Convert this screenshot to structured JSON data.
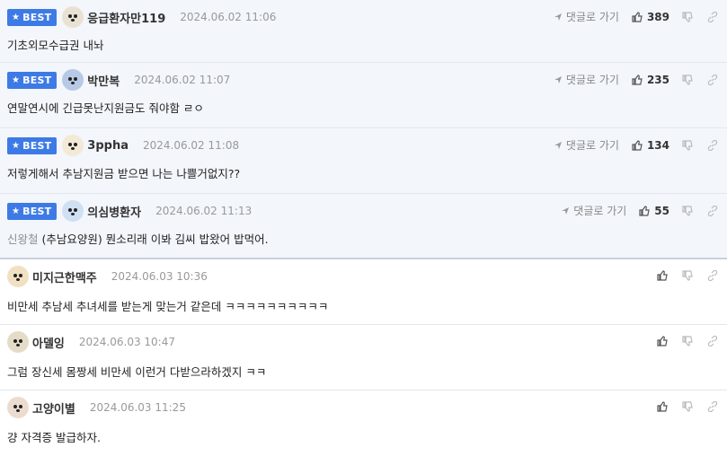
{
  "best_badge": "BEST",
  "reply_label": "댓글로 가기",
  "comments": [
    {
      "nick": "응급환자만119",
      "date": "2024.06.02 11:06",
      "text": "기초외모수급권 내놔",
      "likes": "389",
      "avatar_color": "#e9e2d2"
    },
    {
      "nick": "박만복",
      "date": "2024.06.02 11:07",
      "text": "연말연시에 긴급못난지원금도 줘야함 ㄹㅇ",
      "likes": "235",
      "avatar_color": "#b8c9e6"
    },
    {
      "nick": "3ppha",
      "date": "2024.06.02 11:08",
      "text": "저렇게해서 추남지원금 받으면 나는 나쁠거없지??",
      "likes": "134",
      "avatar_color": "#f2ead6"
    },
    {
      "nick": "의심병환자",
      "date": "2024.06.02 11:13",
      "mention": "신왕철",
      "text": "(추남요양원) 뭔소리래 이봐 김씨 밥왔어 밥먹어.",
      "likes": "55",
      "avatar_color": "#cfe0f2"
    },
    {
      "nick": "미지근한맥주",
      "date": "2024.06.03 10:36",
      "text": "비만세 추남세 추녀세를 받는게 맞는거 같은데 ㅋㅋㅋㅋㅋㅋㅋㅋㅋㅋ",
      "avatar_color": "#efe1c2"
    },
    {
      "nick": "아델잉",
      "date": "2024.06.03 10:47",
      "text": "그럼 장신세 몸짱세 비만세 이런거 다받으라하겠지 ㅋㅋ",
      "avatar_color": "#e5dcc8"
    },
    {
      "nick": "고양이별",
      "date": "2024.06.03 11:25",
      "text": "걍 자격증 발급하자.",
      "avatar_color": "#ecdcd0"
    }
  ]
}
